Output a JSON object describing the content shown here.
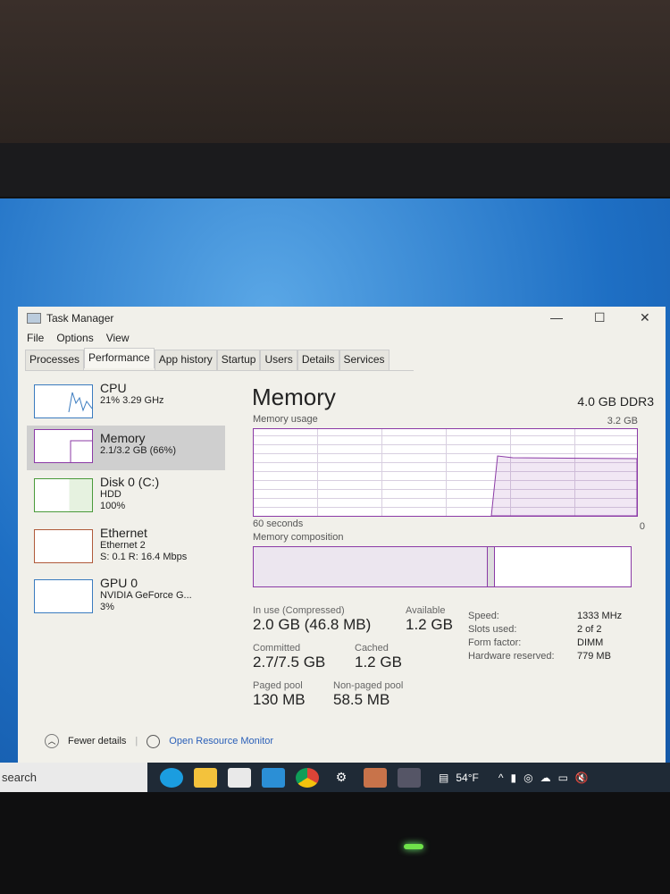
{
  "window": {
    "title": "Task Manager",
    "minimize": "—",
    "maximize": "☐",
    "close": "✕"
  },
  "menu": [
    "File",
    "Options",
    "View"
  ],
  "tabs": [
    "Processes",
    "Performance",
    "App history",
    "Startup",
    "Users",
    "Details",
    "Services"
  ],
  "active_tab": "Performance",
  "sidebar": [
    {
      "name": "CPU",
      "sub1": "21% 3.29 GHz",
      "sub2": ""
    },
    {
      "name": "Memory",
      "sub1": "2.1/3.2 GB (66%)",
      "sub2": ""
    },
    {
      "name": "Disk 0 (C:)",
      "sub1": "HDD",
      "sub2": "100%"
    },
    {
      "name": "Ethernet",
      "sub1": "Ethernet 2",
      "sub2": "S: 0.1 R: 16.4 Mbps"
    },
    {
      "name": "GPU 0",
      "sub1": "NVIDIA GeForce G...",
      "sub2": "3%"
    }
  ],
  "main": {
    "title": "Memory",
    "type": "4.0 GB DDR3",
    "usage_label": "Memory usage",
    "usage_max": "3.2 GB",
    "time_label": "60 seconds",
    "time_min": "0",
    "composition_label": "Memory composition",
    "in_use_label": "In use (Compressed)",
    "in_use": "2.0 GB (46.8 MB)",
    "available_label": "Available",
    "available": "1.2 GB",
    "committed_label": "Committed",
    "committed": "2.7/7.5 GB",
    "cached_label": "Cached",
    "cached": "1.2 GB",
    "paged_label": "Paged pool",
    "paged": "130 MB",
    "nonpaged_label": "Non-paged pool",
    "nonpaged": "58.5 MB",
    "specs": [
      [
        "Speed:",
        "1333 MHz"
      ],
      [
        "Slots used:",
        "2 of 2"
      ],
      [
        "Form factor:",
        "DIMM"
      ],
      [
        "Hardware reserved:",
        "779 MB"
      ]
    ]
  },
  "footer": {
    "fewer": "Fewer details",
    "resmon": "Open Resource Monitor"
  },
  "taskbar": {
    "search": "search",
    "weather": "54°F",
    "icons": [
      "edge-icon",
      "file-explorer-icon",
      "store-icon",
      "mail-icon",
      "chrome-icon",
      "steam-icon",
      "app-icon",
      "task-manager-icon"
    ]
  },
  "colors": {
    "accent": "#8b3aa6",
    "desktop": "#1e6fc4"
  }
}
